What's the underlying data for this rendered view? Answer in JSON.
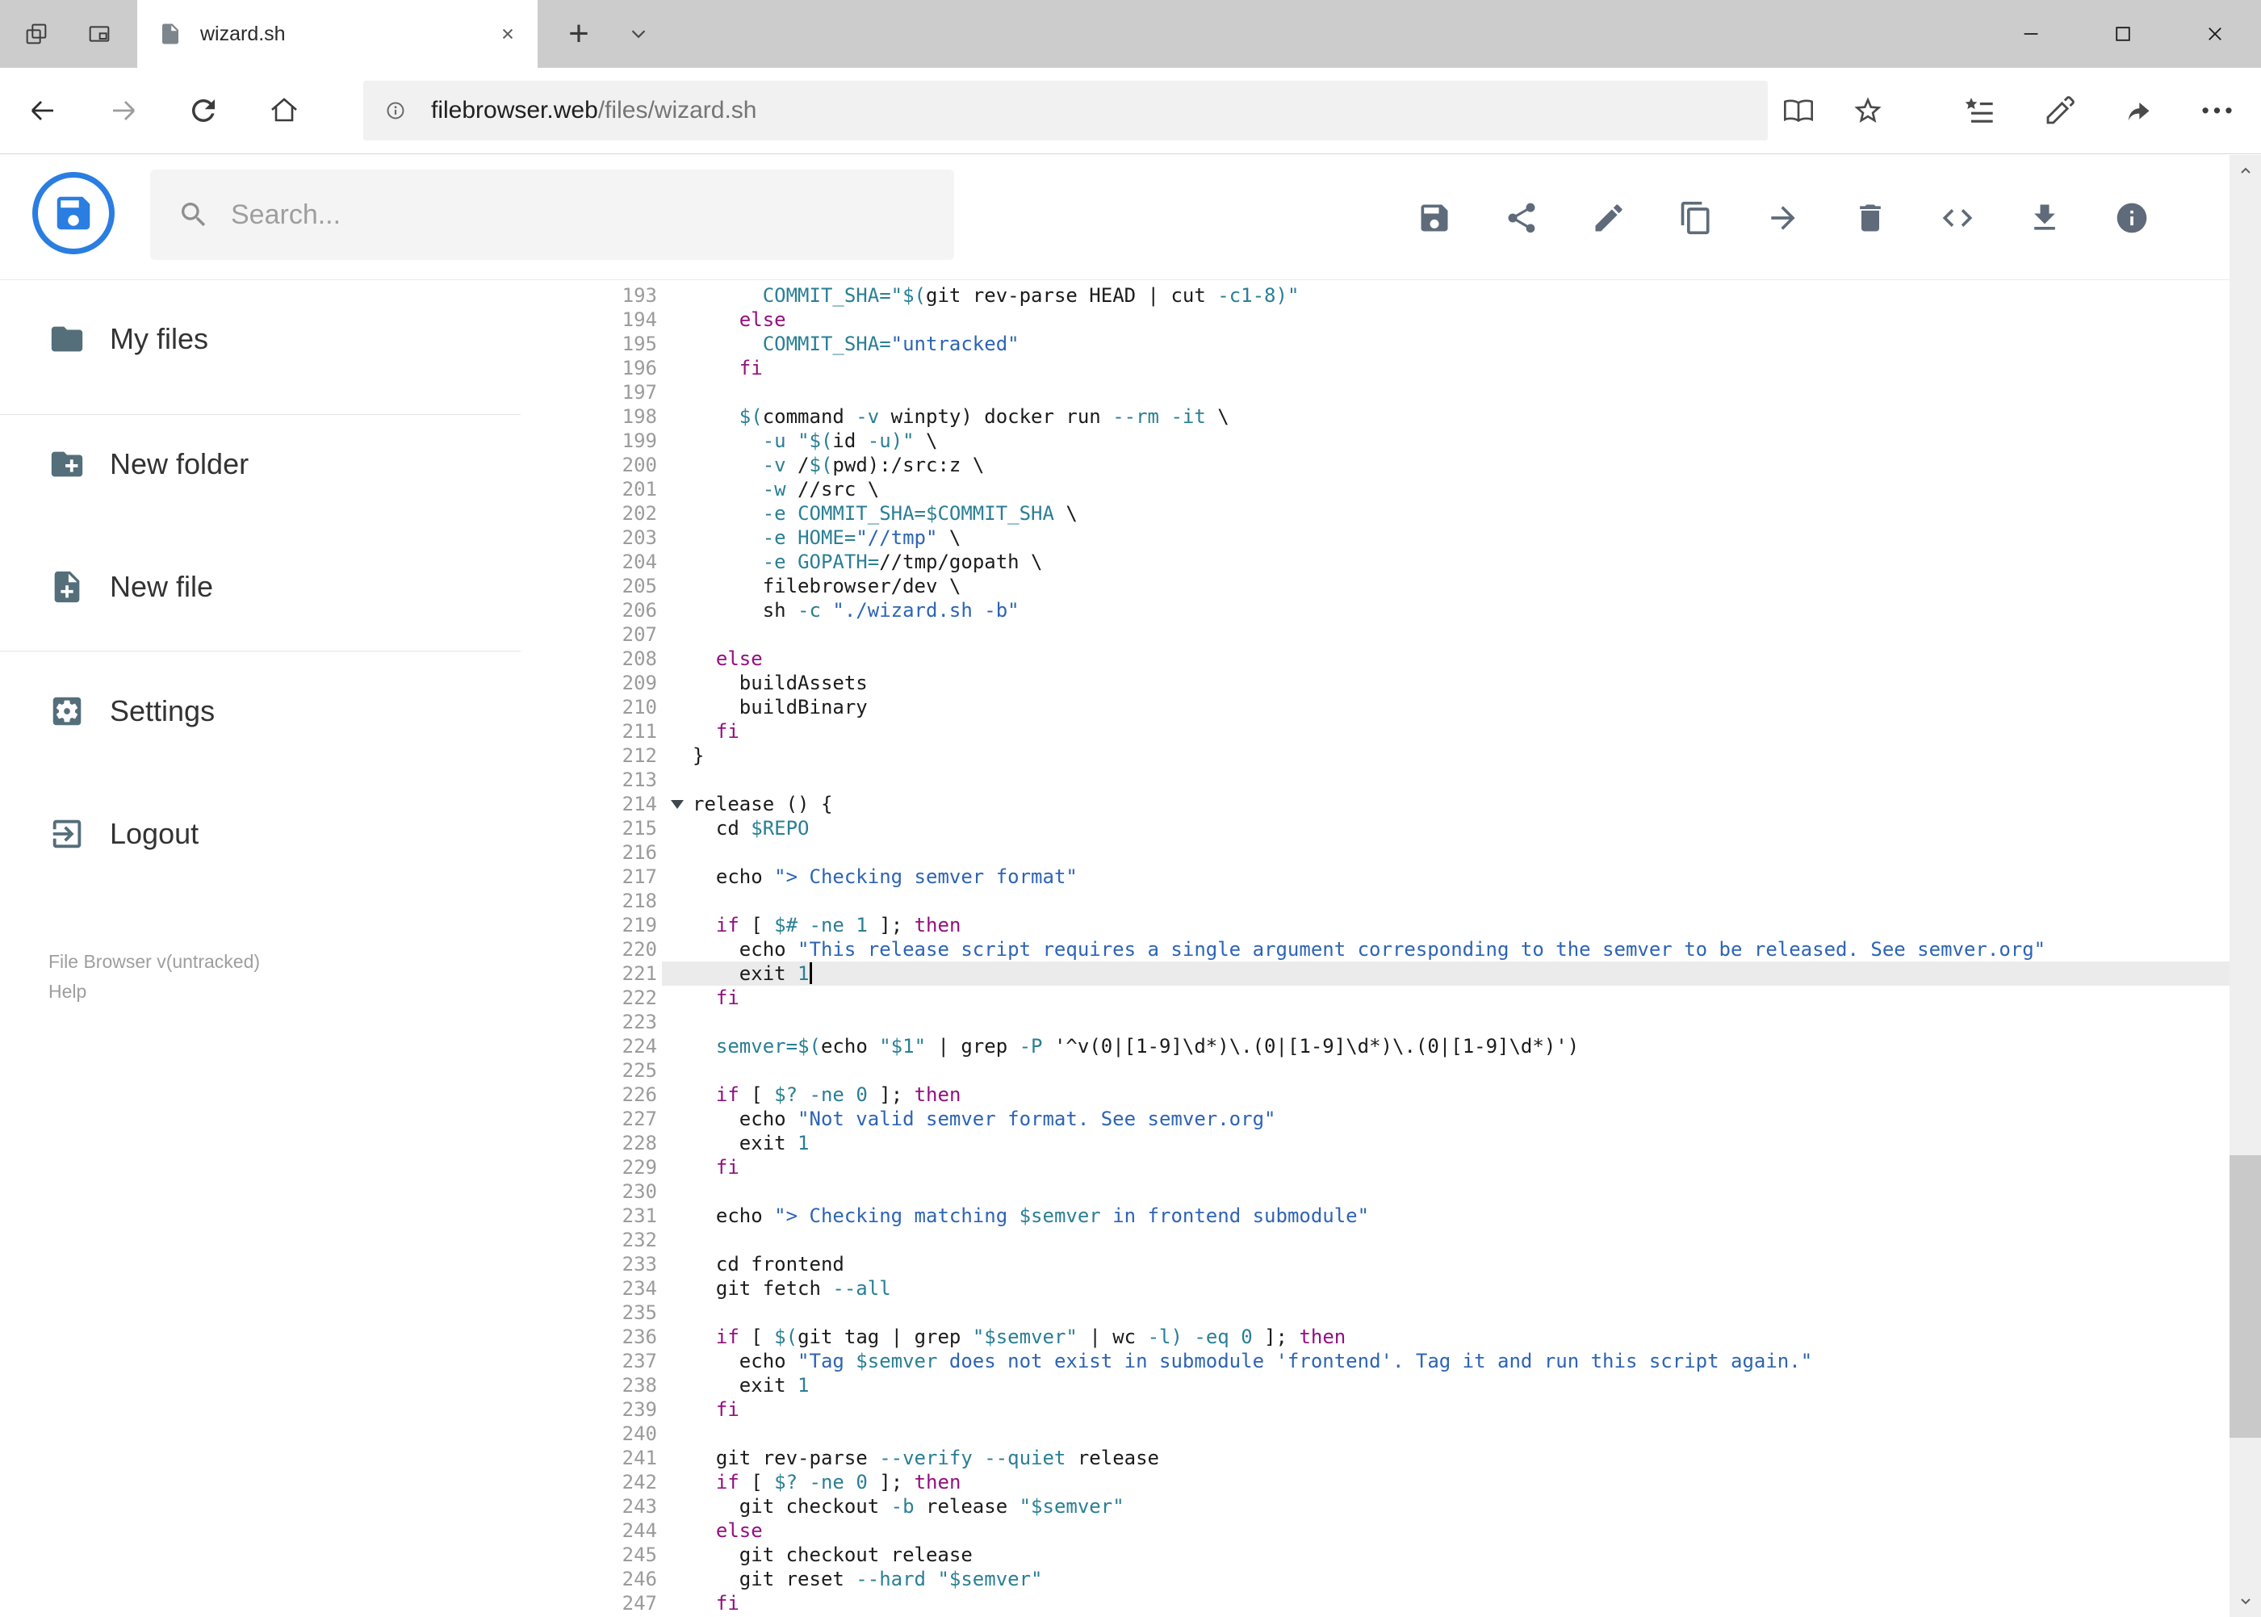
{
  "colors": {
    "accent_blue": "#2a7de1",
    "icon_gray": "#5f6b7a",
    "sidebar_icon": "#546e7a",
    "token_plain": "#1b1b1b",
    "token_keyword": "#930f80",
    "token_variable": "#2a7f95",
    "token_string": "#2d64b5",
    "active_line_bg": "#ebebeb"
  },
  "browser": {
    "tab_title": "wizard.sh",
    "new_tab_glyph": "+",
    "more_glyph": "•••",
    "url_domain": "filebrowser.web",
    "url_path": "/files/wizard.sh"
  },
  "header": {
    "search_placeholder": "Search...",
    "actions": [
      "save",
      "share",
      "rename",
      "copy",
      "move",
      "delete",
      "source-code",
      "download",
      "info"
    ]
  },
  "sidebar": {
    "items": [
      {
        "label": "My files"
      },
      {
        "label": "New folder"
      },
      {
        "label": "New file"
      },
      {
        "label": "Settings"
      },
      {
        "label": "Logout"
      }
    ],
    "footer_version": "File Browser v(untracked)",
    "footer_help": "Help"
  },
  "editor": {
    "active_line": 221,
    "folded_line": 214,
    "lines": [
      {
        "n": 193,
        "s": [
          [
            "      ",
            0
          ],
          [
            "COMMIT_SHA=",
            2
          ],
          [
            "\"$(",
            2
          ],
          [
            "git rev-parse HEAD | cut ",
            0
          ],
          [
            "-c1-8",
            2
          ],
          [
            ")\"",
            2
          ]
        ]
      },
      {
        "n": 194,
        "s": [
          [
            "    ",
            0
          ],
          [
            "else",
            1
          ]
        ]
      },
      {
        "n": 195,
        "s": [
          [
            "      ",
            0
          ],
          [
            "COMMIT_SHA=",
            2
          ],
          [
            "\"untracked\"",
            3
          ]
        ]
      },
      {
        "n": 196,
        "s": [
          [
            "    ",
            0
          ],
          [
            "fi",
            1
          ]
        ]
      },
      {
        "n": 197,
        "s": []
      },
      {
        "n": 198,
        "s": [
          [
            "    ",
            0
          ],
          [
            "$(",
            2
          ],
          [
            "command ",
            0
          ],
          [
            "-v",
            2
          ],
          [
            " winpty) docker run ",
            0
          ],
          [
            "--rm",
            2
          ],
          [
            " ",
            0
          ],
          [
            "-it",
            2
          ],
          [
            " \\",
            0
          ]
        ]
      },
      {
        "n": 199,
        "s": [
          [
            "      ",
            0
          ],
          [
            "-u",
            2
          ],
          [
            " ",
            0
          ],
          [
            "\"$(",
            2
          ],
          [
            "id ",
            0
          ],
          [
            "-u",
            2
          ],
          [
            ")\"",
            2
          ],
          [
            " \\",
            0
          ]
        ]
      },
      {
        "n": 200,
        "s": [
          [
            "      ",
            0
          ],
          [
            "-v",
            2
          ],
          [
            " /",
            0
          ],
          [
            "$(",
            2
          ],
          [
            "pwd",
            0
          ],
          [
            "):/src:z \\",
            0
          ]
        ]
      },
      {
        "n": 201,
        "s": [
          [
            "      ",
            0
          ],
          [
            "-w",
            2
          ],
          [
            " //src \\",
            0
          ]
        ]
      },
      {
        "n": 202,
        "s": [
          [
            "      ",
            0
          ],
          [
            "-e",
            2
          ],
          [
            " ",
            0
          ],
          [
            "COMMIT_SHA=$COMMIT_SHA",
            2
          ],
          [
            " \\",
            0
          ]
        ]
      },
      {
        "n": 203,
        "s": [
          [
            "      ",
            0
          ],
          [
            "-e",
            2
          ],
          [
            " ",
            0
          ],
          [
            "HOME=",
            2
          ],
          [
            "\"//tmp\"",
            3
          ],
          [
            " \\",
            0
          ]
        ]
      },
      {
        "n": 204,
        "s": [
          [
            "      ",
            0
          ],
          [
            "-e",
            2
          ],
          [
            " ",
            0
          ],
          [
            "GOPATH=",
            2
          ],
          [
            "//tmp/gopath \\",
            0
          ]
        ]
      },
      {
        "n": 205,
        "s": [
          [
            "      filebrowser/dev \\",
            0
          ]
        ]
      },
      {
        "n": 206,
        "s": [
          [
            "      sh ",
            0
          ],
          [
            "-c",
            2
          ],
          [
            " ",
            0
          ],
          [
            "\"./wizard.sh -b\"",
            3
          ]
        ]
      },
      {
        "n": 207,
        "s": []
      },
      {
        "n": 208,
        "s": [
          [
            "  ",
            0
          ],
          [
            "else",
            1
          ]
        ]
      },
      {
        "n": 209,
        "s": [
          [
            "    buildAssets",
            0
          ]
        ]
      },
      {
        "n": 210,
        "s": [
          [
            "    buildBinary",
            0
          ]
        ]
      },
      {
        "n": 211,
        "s": [
          [
            "  ",
            0
          ],
          [
            "fi",
            1
          ]
        ]
      },
      {
        "n": 212,
        "s": [
          [
            "}",
            0
          ]
        ]
      },
      {
        "n": 213,
        "s": []
      },
      {
        "n": 214,
        "s": [
          [
            "release () {",
            0
          ]
        ]
      },
      {
        "n": 215,
        "s": [
          [
            "  cd ",
            0
          ],
          [
            "$REPO",
            2
          ]
        ]
      },
      {
        "n": 216,
        "s": []
      },
      {
        "n": 217,
        "s": [
          [
            "  echo ",
            0
          ],
          [
            "\"> Checking semver format\"",
            3
          ]
        ]
      },
      {
        "n": 218,
        "s": []
      },
      {
        "n": 219,
        "s": [
          [
            "  ",
            0
          ],
          [
            "if",
            1
          ],
          [
            " [ ",
            0
          ],
          [
            "$#",
            2
          ],
          [
            " ",
            0
          ],
          [
            "-ne",
            2
          ],
          [
            " ",
            0
          ],
          [
            "1",
            2
          ],
          [
            " ]; ",
            0
          ],
          [
            "then",
            1
          ]
        ]
      },
      {
        "n": 220,
        "s": [
          [
            "    echo ",
            0
          ],
          [
            "\"This release script requires a single argument corresponding to the semver to be released. See semver.org\"",
            3
          ]
        ]
      },
      {
        "n": 221,
        "s": [
          [
            "    exit ",
            0
          ],
          [
            "1",
            2
          ]
        ]
      },
      {
        "n": 222,
        "s": [
          [
            "  ",
            0
          ],
          [
            "fi",
            1
          ]
        ]
      },
      {
        "n": 223,
        "s": []
      },
      {
        "n": 224,
        "s": [
          [
            "  ",
            0
          ],
          [
            "semver=",
            2
          ],
          [
            "$(",
            2
          ],
          [
            "echo ",
            0
          ],
          [
            "\"$1\"",
            2
          ],
          [
            " | grep ",
            0
          ],
          [
            "-P",
            2
          ],
          [
            " '^v(0|[1-9]\\d*)\\.(0|[1-9]\\d*)\\.(0|[1-9]\\d*)')",
            0
          ]
        ]
      },
      {
        "n": 225,
        "s": []
      },
      {
        "n": 226,
        "s": [
          [
            "  ",
            0
          ],
          [
            "if",
            1
          ],
          [
            " [ ",
            0
          ],
          [
            "$?",
            2
          ],
          [
            " ",
            0
          ],
          [
            "-ne",
            2
          ],
          [
            " ",
            0
          ],
          [
            "0",
            2
          ],
          [
            " ]; ",
            0
          ],
          [
            "then",
            1
          ]
        ]
      },
      {
        "n": 227,
        "s": [
          [
            "    echo ",
            0
          ],
          [
            "\"Not valid semver format. See semver.org\"",
            3
          ]
        ]
      },
      {
        "n": 228,
        "s": [
          [
            "    exit ",
            0
          ],
          [
            "1",
            2
          ]
        ]
      },
      {
        "n": 229,
        "s": [
          [
            "  ",
            0
          ],
          [
            "fi",
            1
          ]
        ]
      },
      {
        "n": 230,
        "s": []
      },
      {
        "n": 231,
        "s": [
          [
            "  echo ",
            0
          ],
          [
            "\"> Checking matching ",
            3
          ],
          [
            "$semver",
            2
          ],
          [
            " in frontend submodule\"",
            3
          ]
        ]
      },
      {
        "n": 232,
        "s": []
      },
      {
        "n": 233,
        "s": [
          [
            "  cd frontend",
            0
          ]
        ]
      },
      {
        "n": 234,
        "s": [
          [
            "  git fetch ",
            0
          ],
          [
            "--all",
            2
          ]
        ]
      },
      {
        "n": 235,
        "s": []
      },
      {
        "n": 236,
        "s": [
          [
            "  ",
            0
          ],
          [
            "if",
            1
          ],
          [
            " [ ",
            0
          ],
          [
            "$(",
            2
          ],
          [
            "git tag | grep ",
            0
          ],
          [
            "\"$semver\"",
            2
          ],
          [
            " | wc ",
            0
          ],
          [
            "-l",
            2
          ],
          [
            ")",
            2
          ],
          [
            " ",
            0
          ],
          [
            "-eq",
            2
          ],
          [
            " ",
            0
          ],
          [
            "0",
            2
          ],
          [
            " ]; ",
            0
          ],
          [
            "then",
            1
          ]
        ]
      },
      {
        "n": 237,
        "s": [
          [
            "    echo ",
            0
          ],
          [
            "\"Tag ",
            3
          ],
          [
            "$semver",
            2
          ],
          [
            " does not exist in submodule 'frontend'. Tag it and run this script again.\"",
            3
          ]
        ]
      },
      {
        "n": 238,
        "s": [
          [
            "    exit ",
            0
          ],
          [
            "1",
            2
          ]
        ]
      },
      {
        "n": 239,
        "s": [
          [
            "  ",
            0
          ],
          [
            "fi",
            1
          ]
        ]
      },
      {
        "n": 240,
        "s": []
      },
      {
        "n": 241,
        "s": [
          [
            "  git rev-parse ",
            0
          ],
          [
            "--verify",
            2
          ],
          [
            " ",
            0
          ],
          [
            "--quiet",
            2
          ],
          [
            " release",
            0
          ]
        ]
      },
      {
        "n": 242,
        "s": [
          [
            "  ",
            0
          ],
          [
            "if",
            1
          ],
          [
            " [ ",
            0
          ],
          [
            "$?",
            2
          ],
          [
            " ",
            0
          ],
          [
            "-ne",
            2
          ],
          [
            " ",
            0
          ],
          [
            "0",
            2
          ],
          [
            " ]; ",
            0
          ],
          [
            "then",
            1
          ]
        ]
      },
      {
        "n": 243,
        "s": [
          [
            "    git checkout ",
            0
          ],
          [
            "-b",
            2
          ],
          [
            " release ",
            0
          ],
          [
            "\"$semver\"",
            2
          ]
        ]
      },
      {
        "n": 244,
        "s": [
          [
            "  ",
            0
          ],
          [
            "else",
            1
          ]
        ]
      },
      {
        "n": 245,
        "s": [
          [
            "    git checkout release",
            0
          ]
        ]
      },
      {
        "n": 246,
        "s": [
          [
            "    git reset ",
            0
          ],
          [
            "--hard",
            2
          ],
          [
            " ",
            0
          ],
          [
            "\"$semver\"",
            2
          ]
        ]
      },
      {
        "n": 247,
        "s": [
          [
            "  ",
            0
          ],
          [
            "fi",
            1
          ]
        ]
      }
    ]
  }
}
